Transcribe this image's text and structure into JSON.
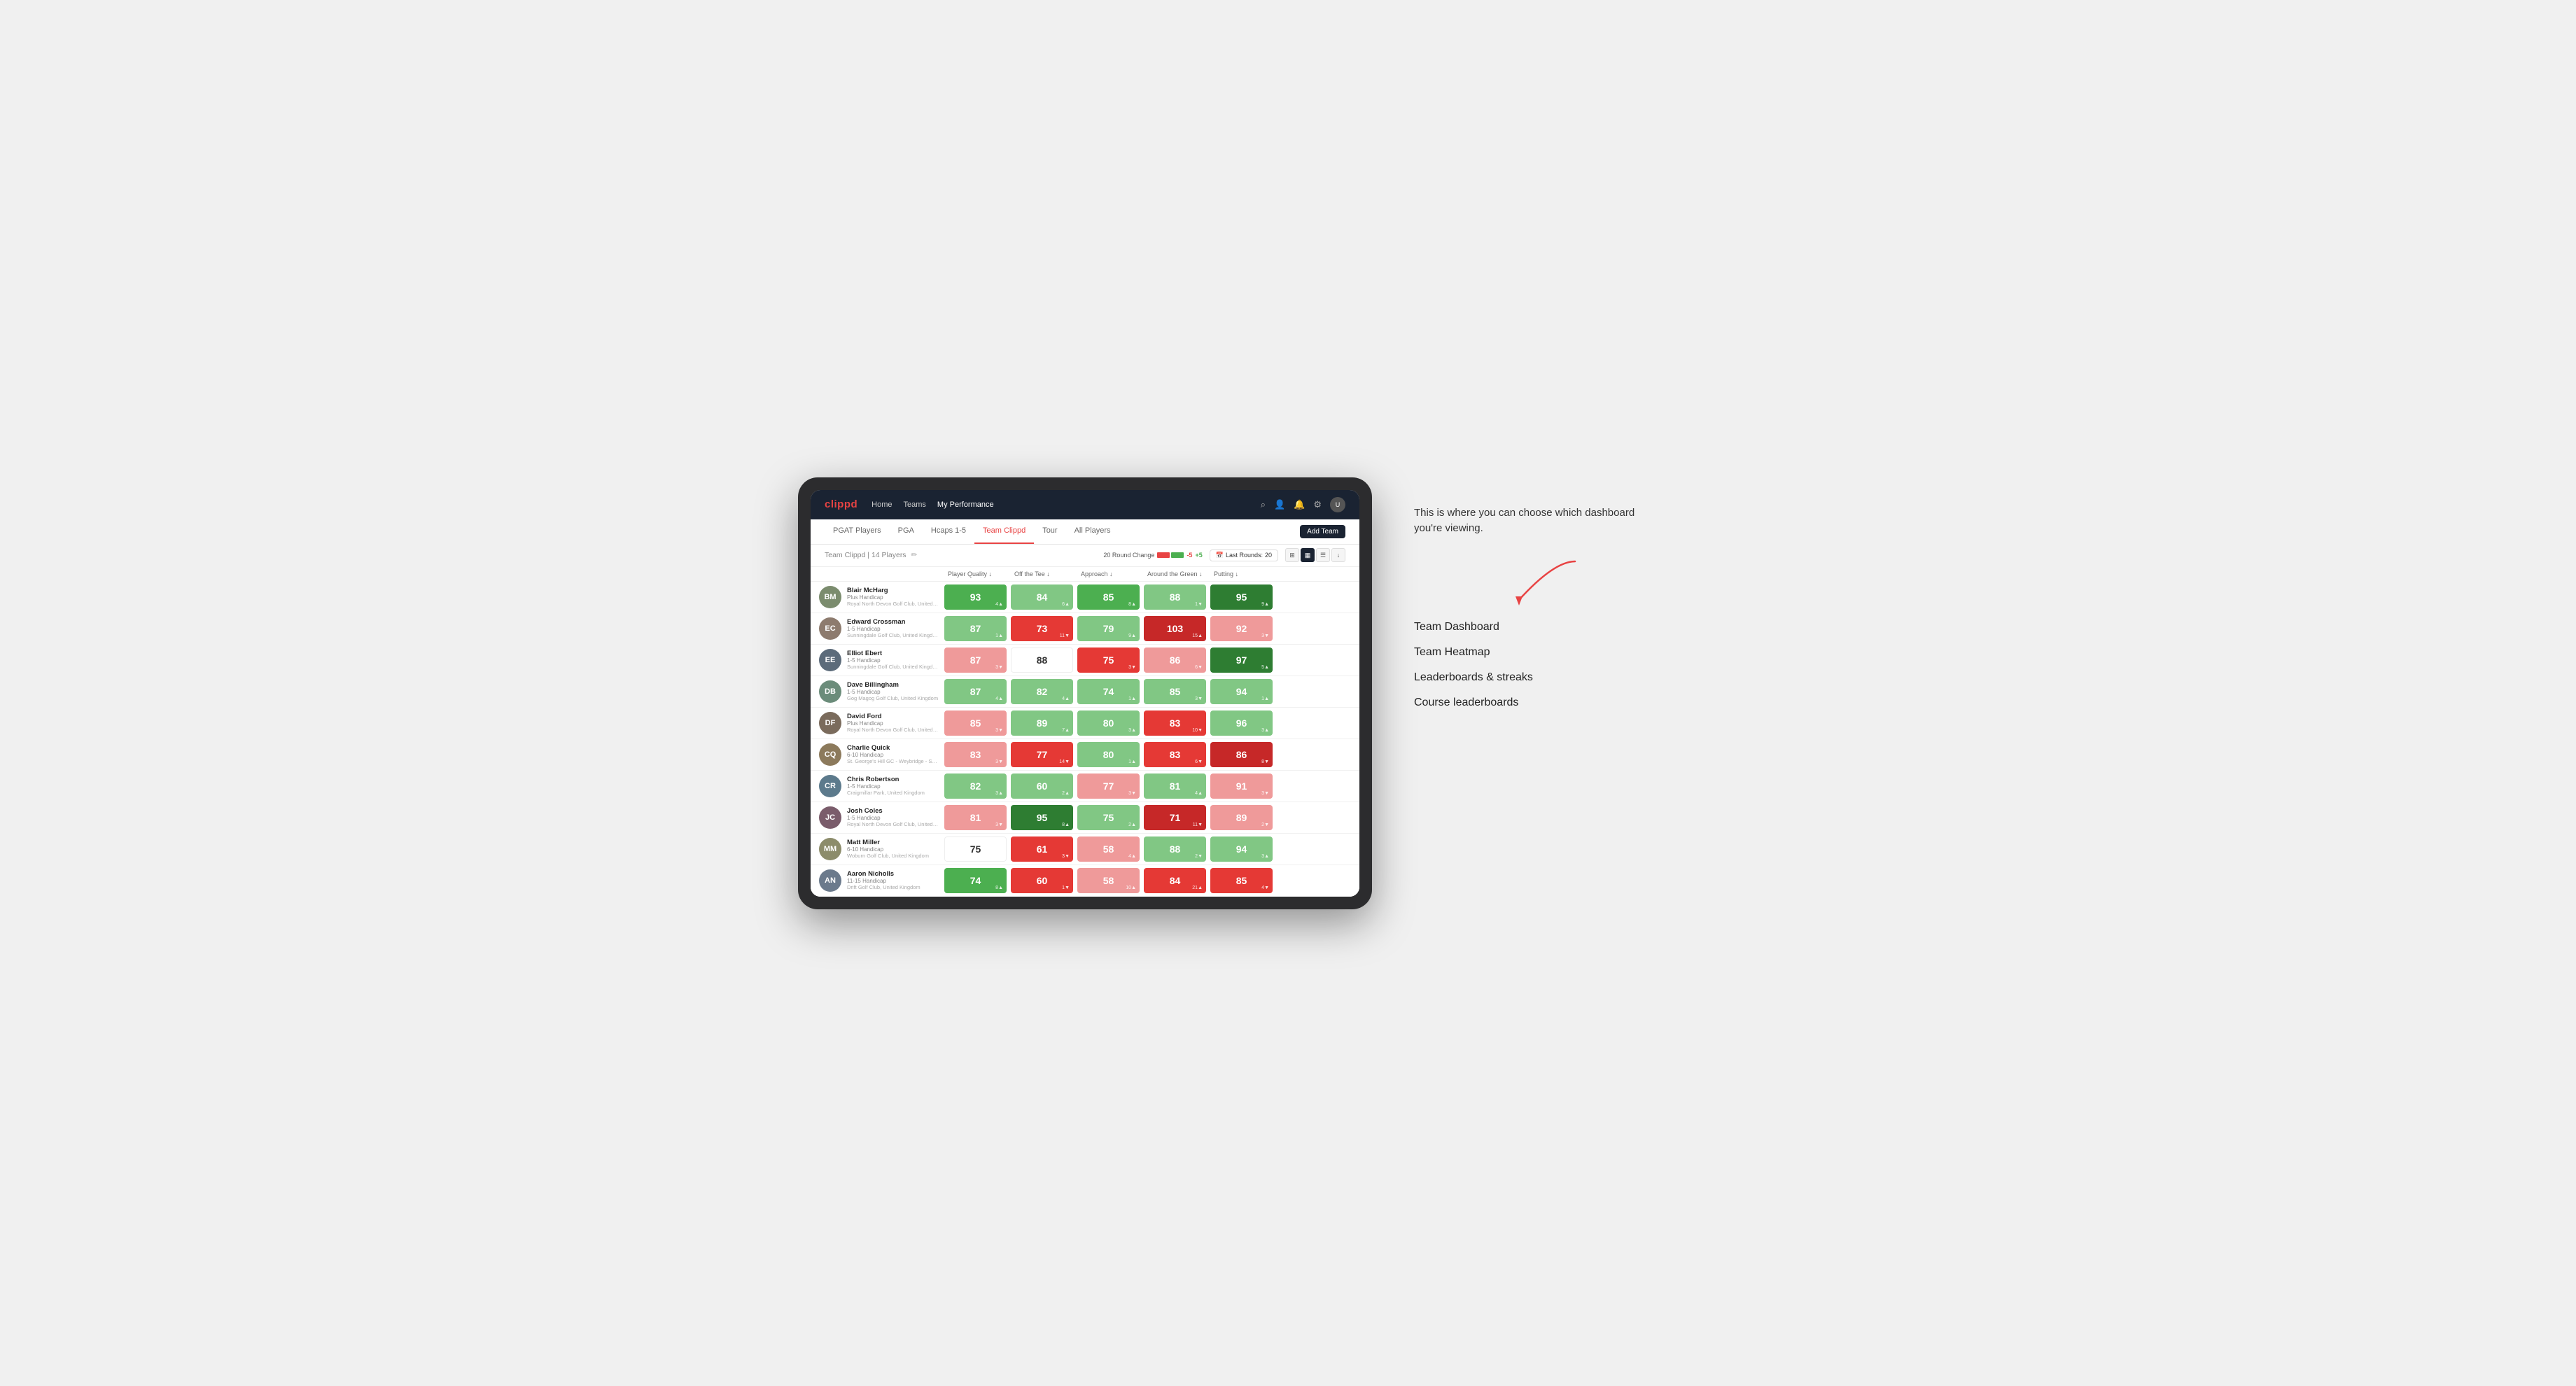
{
  "annotation": {
    "intro_text": "This is where you can choose which dashboard you're viewing.",
    "options": [
      "Team Dashboard",
      "Team Heatmap",
      "Leaderboards & streaks",
      "Course leaderboards"
    ]
  },
  "nav": {
    "logo": "clippd",
    "links": [
      "Home",
      "Teams",
      "My Performance"
    ],
    "active_link": "My Performance"
  },
  "sub_tabs": [
    "PGAT Players",
    "PGA",
    "Hcaps 1-5",
    "Team Clippd",
    "Tour",
    "All Players"
  ],
  "active_sub_tab": "Team Clippd",
  "add_team_label": "Add Team",
  "team": {
    "name": "Team Clippd",
    "player_count": "14 Players",
    "round_change_label": "20 Round Change",
    "change_neg": "-5",
    "change_pos": "+5",
    "last_rounds_label": "Last Rounds:",
    "last_rounds_value": "20"
  },
  "columns": [
    "Player Quality ↓",
    "Off the Tee ↓",
    "Approach ↓",
    "Around the Green ↓",
    "Putting ↓"
  ],
  "players": [
    {
      "name": "Blair McHarg",
      "handicap": "Plus Handicap",
      "club": "Royal North Devon Golf Club, United Kingdom",
      "avatar_color": "#7b8c6e",
      "initials": "BM",
      "stats": [
        {
          "value": "93",
          "change": "4▲",
          "color": "green-mid"
        },
        {
          "value": "84",
          "change": "6▲",
          "color": "green-light"
        },
        {
          "value": "85",
          "change": "8▲",
          "color": "green-mid"
        },
        {
          "value": "88",
          "change": "1▼",
          "color": "green-light"
        },
        {
          "value": "95",
          "change": "9▲",
          "color": "green-dark"
        }
      ]
    },
    {
      "name": "Edward Crossman",
      "handicap": "1-5 Handicap",
      "club": "Sunningdale Golf Club, United Kingdom",
      "avatar_color": "#8d7b6e",
      "initials": "EC",
      "stats": [
        {
          "value": "87",
          "change": "1▲",
          "color": "green-light"
        },
        {
          "value": "73",
          "change": "11▼",
          "color": "red-mid"
        },
        {
          "value": "79",
          "change": "9▲",
          "color": "green-light"
        },
        {
          "value": "103",
          "change": "15▲",
          "color": "red-dark"
        },
        {
          "value": "92",
          "change": "3▼",
          "color": "red-light"
        }
      ]
    },
    {
      "name": "Elliot Ebert",
      "handicap": "1-5 Handicap",
      "club": "Sunningdale Golf Club, United Kingdom",
      "avatar_color": "#5c6b7a",
      "initials": "EE",
      "stats": [
        {
          "value": "87",
          "change": "3▼",
          "color": "red-light"
        },
        {
          "value": "88",
          "change": "",
          "color": "white"
        },
        {
          "value": "75",
          "change": "3▼",
          "color": "red-mid"
        },
        {
          "value": "86",
          "change": "6▼",
          "color": "red-light"
        },
        {
          "value": "97",
          "change": "5▲",
          "color": "green-dark"
        }
      ]
    },
    {
      "name": "Dave Billingham",
      "handicap": "1-5 Handicap",
      "club": "Gog Magog Golf Club, United Kingdom",
      "avatar_color": "#6b8c7a",
      "initials": "DB",
      "stats": [
        {
          "value": "87",
          "change": "4▲",
          "color": "green-light"
        },
        {
          "value": "82",
          "change": "4▲",
          "color": "green-light"
        },
        {
          "value": "74",
          "change": "1▲",
          "color": "green-light"
        },
        {
          "value": "85",
          "change": "3▼",
          "color": "green-light"
        },
        {
          "value": "94",
          "change": "1▲",
          "color": "green-light"
        }
      ]
    },
    {
      "name": "David Ford",
      "handicap": "Plus Handicap",
      "club": "Royal North Devon Golf Club, United Kingdom",
      "avatar_color": "#7a6b5c",
      "initials": "DF",
      "stats": [
        {
          "value": "85",
          "change": "3▼",
          "color": "red-light"
        },
        {
          "value": "89",
          "change": "7▲",
          "color": "green-light"
        },
        {
          "value": "80",
          "change": "3▲",
          "color": "green-light"
        },
        {
          "value": "83",
          "change": "10▼",
          "color": "red-mid"
        },
        {
          "value": "96",
          "change": "3▲",
          "color": "green-light"
        }
      ]
    },
    {
      "name": "Charlie Quick",
      "handicap": "6-10 Handicap",
      "club": "St. George's Hill GC - Weybridge - Surrey, Uni...",
      "avatar_color": "#8c7a5c",
      "initials": "CQ",
      "stats": [
        {
          "value": "83",
          "change": "3▼",
          "color": "red-light"
        },
        {
          "value": "77",
          "change": "14▼",
          "color": "red-mid"
        },
        {
          "value": "80",
          "change": "1▲",
          "color": "green-light"
        },
        {
          "value": "83",
          "change": "6▼",
          "color": "red-mid"
        },
        {
          "value": "86",
          "change": "8▼",
          "color": "red-dark"
        }
      ]
    },
    {
      "name": "Chris Robertson",
      "handicap": "1-5 Handicap",
      "club": "Craigmillar Park, United Kingdom",
      "avatar_color": "#5c7a8c",
      "initials": "CR",
      "stats": [
        {
          "value": "82",
          "change": "3▲",
          "color": "green-light"
        },
        {
          "value": "60",
          "change": "2▲",
          "color": "green-light"
        },
        {
          "value": "77",
          "change": "3▼",
          "color": "red-light"
        },
        {
          "value": "81",
          "change": "4▲",
          "color": "green-light"
        },
        {
          "value": "91",
          "change": "3▼",
          "color": "red-light"
        }
      ]
    },
    {
      "name": "Josh Coles",
      "handicap": "1-5 Handicap",
      "club": "Royal North Devon Golf Club, United Kingdom",
      "avatar_color": "#7a5c6b",
      "initials": "JC",
      "stats": [
        {
          "value": "81",
          "change": "3▼",
          "color": "red-light"
        },
        {
          "value": "95",
          "change": "8▲",
          "color": "green-dark"
        },
        {
          "value": "75",
          "change": "2▲",
          "color": "green-light"
        },
        {
          "value": "71",
          "change": "11▼",
          "color": "red-dark"
        },
        {
          "value": "89",
          "change": "2▼",
          "color": "red-light"
        }
      ]
    },
    {
      "name": "Matt Miller",
      "handicap": "6-10 Handicap",
      "club": "Woburn Golf Club, United Kingdom",
      "avatar_color": "#8c8c6b",
      "initials": "MM",
      "stats": [
        {
          "value": "75",
          "change": "",
          "color": "white"
        },
        {
          "value": "61",
          "change": "3▼",
          "color": "red-mid"
        },
        {
          "value": "58",
          "change": "4▲",
          "color": "red-light"
        },
        {
          "value": "88",
          "change": "2▼",
          "color": "green-light"
        },
        {
          "value": "94",
          "change": "3▲",
          "color": "green-light"
        }
      ]
    },
    {
      "name": "Aaron Nicholls",
      "handicap": "11-15 Handicap",
      "club": "Drift Golf Club, United Kingdom",
      "avatar_color": "#6b7a8c",
      "initials": "AN",
      "stats": [
        {
          "value": "74",
          "change": "8▲",
          "color": "green-mid"
        },
        {
          "value": "60",
          "change": "1▼",
          "color": "red-mid"
        },
        {
          "value": "58",
          "change": "10▲",
          "color": "red-light"
        },
        {
          "value": "84",
          "change": "21▲",
          "color": "red-mid"
        },
        {
          "value": "85",
          "change": "4▼",
          "color": "red-mid"
        }
      ]
    }
  ]
}
